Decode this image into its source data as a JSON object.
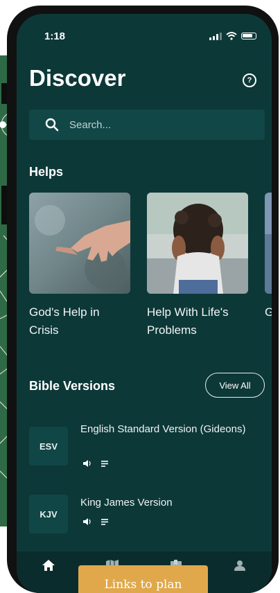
{
  "status_bar": {
    "time": "1:18"
  },
  "header": {
    "title": "Discover",
    "help_icon": "question-circle-icon"
  },
  "search": {
    "placeholder": "Search..."
  },
  "helps": {
    "title": "Helps",
    "items": [
      {
        "label": "God's Help in Crisis",
        "image": "reaching-hand-photo"
      },
      {
        "label": "Help With Life's Problems",
        "image": "distressed-person-photo"
      },
      {
        "label": "G… T…",
        "image": "partial-photo"
      }
    ]
  },
  "bible_versions": {
    "title": "Bible Versions",
    "view_all_label": "View All",
    "items": [
      {
        "abbr": "ESV",
        "name": "English Standard Version (Gideons)",
        "icons": [
          "audio-icon",
          "text-icon"
        ]
      },
      {
        "abbr": "KJV",
        "name": "King James Version",
        "icons": [
          "audio-icon",
          "text-icon"
        ]
      }
    ]
  },
  "bottom_nav": {
    "items": [
      {
        "icon": "home-icon",
        "active": true
      },
      {
        "icon": "map-icon",
        "active": false
      },
      {
        "icon": "bookmark-icon",
        "active": false
      },
      {
        "icon": "profile-icon",
        "active": false
      }
    ]
  },
  "overlay": {
    "tooltip_text": "Links to plan"
  },
  "colors": {
    "screen_bg": "#0d3838",
    "card_bg": "#114747",
    "nav_bg": "#0b2c2c",
    "tooltip_bg": "#e0a84a",
    "backdrop_green": "#2f6a46"
  }
}
